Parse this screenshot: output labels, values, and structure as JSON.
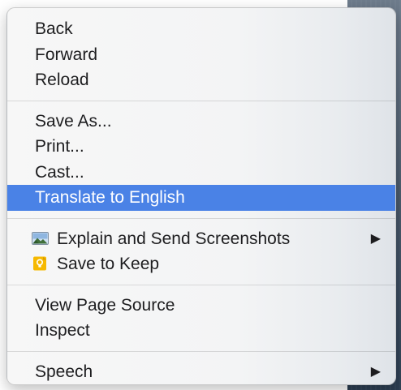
{
  "menu": {
    "items": [
      {
        "label": "Back"
      },
      {
        "label": "Forward"
      },
      {
        "label": "Reload"
      },
      {
        "label": "Save As..."
      },
      {
        "label": "Print..."
      },
      {
        "label": "Cast..."
      },
      {
        "label": "Translate to English",
        "highlighted": true
      },
      {
        "label": "Explain and Send Screenshots",
        "icon": "screenshot-image-icon",
        "submenu": true
      },
      {
        "label": "Save to Keep",
        "icon": "keep-icon"
      },
      {
        "label": "View Page Source"
      },
      {
        "label": "Inspect"
      },
      {
        "label": "Speech",
        "submenu": true
      }
    ],
    "submenu_arrow": "▶",
    "colors": {
      "highlight": "#4a82e6",
      "keep_icon": "#f6b900"
    }
  }
}
